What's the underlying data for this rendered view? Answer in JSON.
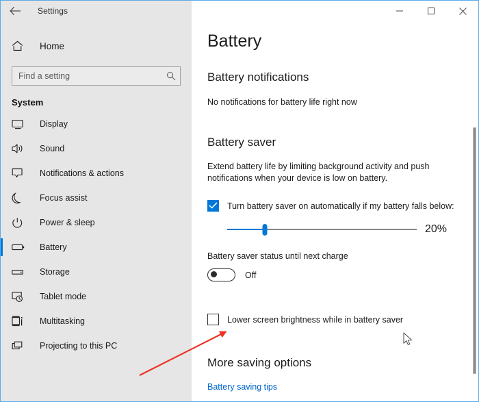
{
  "window": {
    "title": "Settings",
    "back_icon": "back-arrow-icon",
    "minimize_label": "–",
    "maximize_label": "□",
    "close_label": "✕"
  },
  "sidebar": {
    "home": {
      "label": "Home",
      "icon": "home-icon"
    },
    "search": {
      "placeholder": "Find a setting",
      "value": "",
      "icon": "search-icon"
    },
    "group_title": "System",
    "items": [
      {
        "label": "Display",
        "icon": "display-icon",
        "selected": false
      },
      {
        "label": "Sound",
        "icon": "speaker-icon",
        "selected": false
      },
      {
        "label": "Notifications & actions",
        "icon": "notification-icon",
        "selected": false
      },
      {
        "label": "Focus assist",
        "icon": "moon-icon",
        "selected": false
      },
      {
        "label": "Power & sleep",
        "icon": "power-icon",
        "selected": false
      },
      {
        "label": "Battery",
        "icon": "battery-icon",
        "selected": true
      },
      {
        "label": "Storage",
        "icon": "storage-icon",
        "selected": false
      },
      {
        "label": "Tablet mode",
        "icon": "tablet-icon",
        "selected": false
      },
      {
        "label": "Multitasking",
        "icon": "multitasking-icon",
        "selected": false
      },
      {
        "label": "Projecting to this PC",
        "icon": "projecting-icon",
        "selected": false
      }
    ]
  },
  "main": {
    "page_title": "Battery",
    "notifications": {
      "heading": "Battery notifications",
      "status_text": "No notifications for battery life right now"
    },
    "battery_saver": {
      "heading": "Battery saver",
      "description": "Extend battery life by limiting background activity and push notifications when your device is low on battery.",
      "auto_checkbox": {
        "label": "Turn battery saver on automatically if my battery falls below:",
        "checked": true
      },
      "slider": {
        "value_label": "20%",
        "value": 20,
        "min": 0,
        "max": 100
      },
      "toggle": {
        "caption": "Battery saver status until next charge",
        "state_label": "Off",
        "on": false
      },
      "lower_brightness_checkbox": {
        "label": "Lower screen brightness while in battery saver",
        "checked": false
      }
    },
    "more_options": {
      "heading": "More saving options",
      "link_label": "Battery saving tips"
    }
  },
  "colors": {
    "accent": "#0078d7",
    "sidebar_bg": "#e6e6e6",
    "content_bg": "#ffffff",
    "link": "#0066cc",
    "annotation_arrow": "#f03020",
    "window_border": "#5babe8"
  }
}
